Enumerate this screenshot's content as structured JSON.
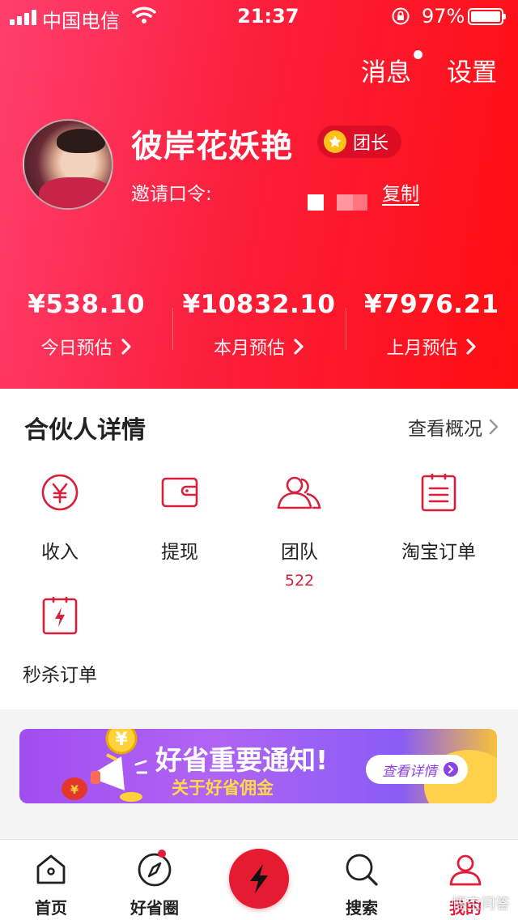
{
  "status_bar": {
    "carrier": "中国电信",
    "time": "21:37",
    "battery": "97%"
  },
  "header": {
    "messages_label": "消息",
    "settings_label": "设置",
    "username": "彼岸花妖艳",
    "badge_label": "团长",
    "invite_label": "邀请口令:",
    "copy_label": "复制"
  },
  "earnings": [
    {
      "amount": "¥538.10",
      "label": "今日预估"
    },
    {
      "amount": "¥10832.10",
      "label": "本月预估"
    },
    {
      "amount": "¥7976.21",
      "label": "上月预估"
    }
  ],
  "partner": {
    "title": "合伙人详情",
    "overview_label": "查看概况",
    "items": [
      {
        "label": "收入",
        "icon": "yen-circle-icon"
      },
      {
        "label": "提现",
        "icon": "wallet-icon"
      },
      {
        "label": "团队",
        "icon": "team-icon",
        "count": "522"
      },
      {
        "label": "淘宝订单",
        "icon": "order-list-icon"
      },
      {
        "label": "秒杀订单",
        "icon": "flash-order-icon"
      }
    ]
  },
  "banner": {
    "title": "好省重要通知!",
    "subtitle": "关于好省佣金",
    "button_label": "查看详情"
  },
  "tabbar": {
    "items": [
      {
        "label": "首页",
        "icon": "home-icon"
      },
      {
        "label": "好省圈",
        "icon": "compass-icon"
      },
      {
        "label": "",
        "icon": "lightning-icon"
      },
      {
        "label": "搜索",
        "icon": "search-icon"
      },
      {
        "label": "我的",
        "icon": "user-icon"
      }
    ],
    "active_index": 4
  },
  "watermark": "悟空问答",
  "colors": {
    "brand_red": "#fb1f3c",
    "gradient_start": "#ff3f6e",
    "gradient_end": "#ff0d10",
    "icon_red": "#d81f3c",
    "banner_purple": "#a04df0",
    "banner_yellow": "#ffd84a"
  }
}
